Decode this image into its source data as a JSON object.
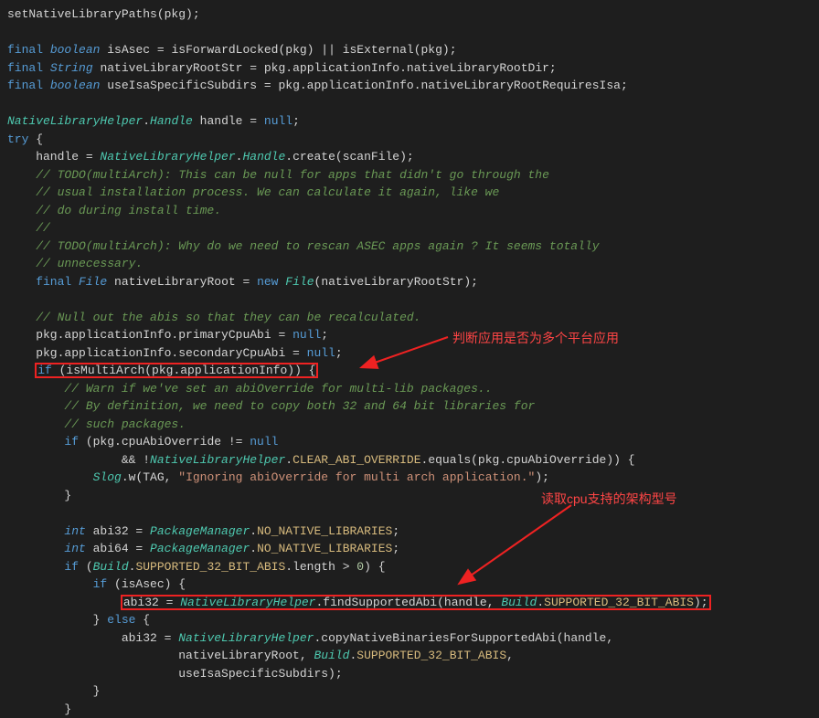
{
  "code": {
    "l1": "setNativeLibraryPaths(pkg);",
    "l3a": "final",
    "l3b": "boolean",
    "l3c": "isAsec = isForwardLocked(pkg) || isExternal(pkg);",
    "l4a": "final",
    "l4b": "String",
    "l4c": "nativeLibraryRootStr = pkg.applicationInfo.nativeLibraryRootDir;",
    "l5a": "final",
    "l5b": "boolean",
    "l5c": "useIsaSpecificSubdirs = pkg.applicationInfo.nativeLibraryRootRequiresIsa;",
    "l7a": "NativeLibraryHelper",
    "l7b": "Handle",
    "l7c": "handle = ",
    "l7d": "null",
    "l7e": ";",
    "l8a": "try",
    "l8b": " {",
    "l9a": "    handle = ",
    "l9b": "NativeLibraryHelper",
    "l9c": ".",
    "l9d": "Handle",
    "l9e": ".create(scanFile);",
    "l10": "    // TODO(multiArch): This can be null for apps that didn't go through the",
    "l11": "    // usual installation process. We can calculate it again, like we",
    "l12": "    // do during install time.",
    "l13": "    //",
    "l14": "    // TODO(multiArch): Why do we need to rescan ASEC apps again ? It seems totally",
    "l15": "    // unnecessary.",
    "l16a": "    final",
    "l16b": "File",
    "l16c": " nativeLibraryRoot = ",
    "l16d": "new",
    "l16e": "File",
    "l16f": "(nativeLibraryRootStr);",
    "l18": "    // Null out the abis so that they can be recalculated.",
    "l19a": "    pkg.applicationInfo.primaryCpuAbi = ",
    "l19b": "null",
    "l19c": ";",
    "l20a": "    pkg.applicationInfo.secondaryCpuAbi = ",
    "l20b": "null",
    "l20c": ";",
    "l21a": "if",
    "l21b": " (isMultiArch(pkg.applicationInfo)) {",
    "l22": "        // Warn if we've set an abiOverride for multi-lib packages..",
    "l23": "        // By definition, we need to copy both 32 and 64 bit libraries for",
    "l24": "        // such packages.",
    "l25a": "        if",
    "l25b": " (pkg.cpuAbiOverride != ",
    "l25c": "null",
    "l26a": "                && !",
    "l26b": "NativeLibraryHelper",
    "l26c": ".",
    "l26d": "CLEAR_ABI_OVERRIDE",
    "l26e": ".equals(pkg.cpuAbiOverride)) {",
    "l27a": "            ",
    "l27b": "Slog",
    "l27c": ".w(TAG, ",
    "l27d": "\"Ignoring abiOverride for multi arch application.\"",
    "l27e": ");",
    "l28": "        }",
    "l30a": "        int",
    "l30b": " abi32 = ",
    "l30c": "PackageManager",
    "l30d": ".",
    "l30e": "NO_NATIVE_LIBRARIES",
    "l30f": ";",
    "l31a": "        int",
    "l31b": " abi64 = ",
    "l31c": "PackageManager",
    "l31d": ".",
    "l31e": "NO_NATIVE_LIBRARIES",
    "l31f": ";",
    "l32a": "        if",
    "l32b": " (",
    "l32c": "Build",
    "l32d": ".",
    "l32e": "SUPPORTED_32_BIT_ABIS",
    "l32f": ".length > ",
    "l32g": "0",
    "l32h": ") {",
    "l33a": "            if",
    "l33b": " (isAsec) {",
    "l34a": "abi32 = ",
    "l34b": "NativeLibraryHelper",
    "l34c": ".findSupportedAbi(handle, ",
    "l34d": "Build",
    "l34e": ".",
    "l34f": "SUPPORTED_32_BIT_ABIS",
    "l34g": ");",
    "l35a": "            } ",
    "l35b": "else",
    "l35c": " {",
    "l36a": "                abi32 = ",
    "l36b": "NativeLibraryHelper",
    "l36c": ".copyNativeBinariesForSupportedAbi(handle,",
    "l37a": "                        nativeLibraryRoot, ",
    "l37b": "Build",
    "l37c": ".",
    "l37d": "SUPPORTED_32_BIT_ABIS",
    "l37e": ",",
    "l38": "                        useIsaSpecificSubdirs);",
    "l39": "            }",
    "l40": "        }"
  },
  "annotations": {
    "ann1": "判断应用是否为多个平台应用",
    "ann2": "读取cpu支持的架构型号"
  }
}
